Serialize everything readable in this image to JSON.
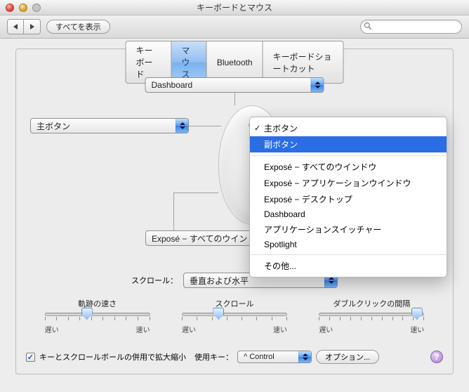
{
  "window": {
    "title": "キーボードとマウス"
  },
  "toolbar": {
    "show_all": "すべてを表示",
    "search_placeholder": ""
  },
  "tabs": [
    "キーボード",
    "マウス",
    "Bluetooth",
    "キーボードショートカット"
  ],
  "active_tab": 1,
  "mouse": {
    "top_popup": "Dashboard",
    "left_popup": "主ボタン",
    "bottom_popup": "Exposé − すべてのウインドウ"
  },
  "right_menu": {
    "checked_index": 0,
    "selected_index": 1,
    "groups": [
      [
        "主ボタン",
        "副ボタン"
      ],
      [
        "Exposé − すべてのウインドウ",
        "Exposé − アプリケーションウインドウ",
        "Exposé − デスクトップ",
        "Dashboard",
        "アプリケーションスイッチャー",
        "Spotlight"
      ],
      [
        "その他..."
      ]
    ]
  },
  "scroll": {
    "label": "スクロール：",
    "value": "垂直および水平"
  },
  "sliders": {
    "track": {
      "title": "軌跡の速さ",
      "left": "遅い",
      "right": "速い",
      "pos": 0.4
    },
    "scroll": {
      "title": "スクロール",
      "left": "遅い",
      "right": "速い",
      "pos": 0.35
    },
    "dcl": {
      "title": "ダブルクリックの間隔",
      "left": "遅い",
      "right": "速い",
      "pos": 0.93
    }
  },
  "bottom": {
    "checkbox_label": "キーとスクロールボールの併用で拡大縮小",
    "checked": true,
    "modifier_label": "使用キー：",
    "modifier_value": "^ Control",
    "options_btn": "オプション..."
  }
}
